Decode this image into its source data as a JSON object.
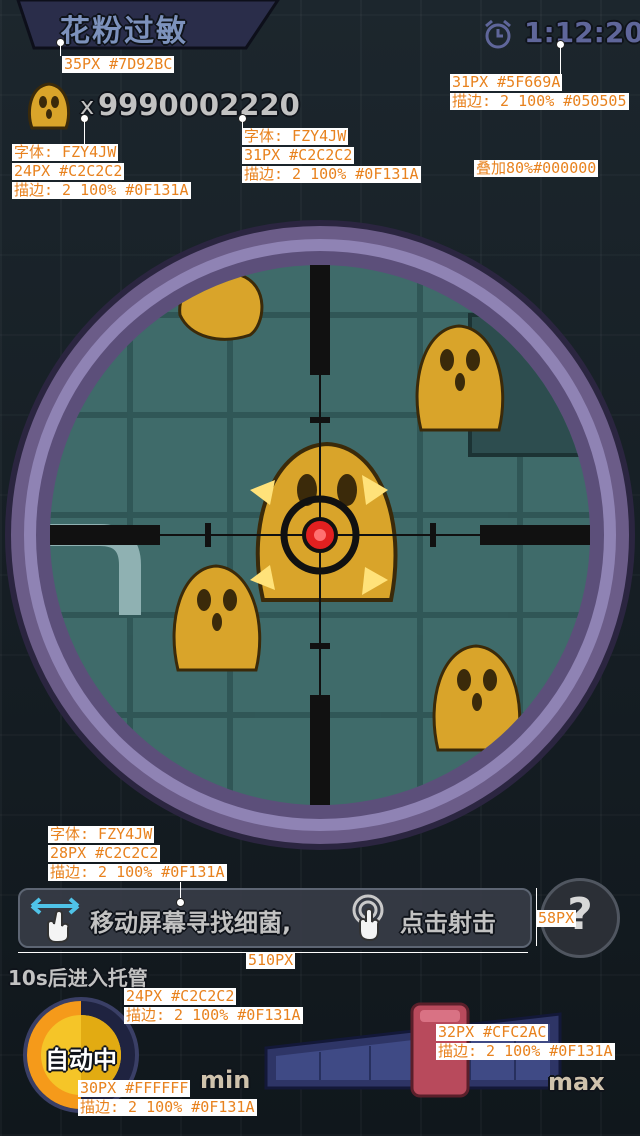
{
  "header": {
    "title": "花粉过敏",
    "timer": "1:12:20",
    "multiplier_prefix": "x",
    "count": "9990002220"
  },
  "scope": {
    "ring_color": "#7a6c9a",
    "lens_color": "#3f6b6a"
  },
  "hint": {
    "move_text": "移动屏幕寻找细菌,",
    "tap_text": "点击射击",
    "help_symbol": "?"
  },
  "auto": {
    "countdown_text": "10s后进入托管",
    "button_label": "自动中"
  },
  "power": {
    "min_label": "min",
    "max_label": "max"
  },
  "annotations": {
    "a1": "35PX #7D92BC",
    "a2": "31PX #5F669A",
    "a3": "描边: 2 100% #050505",
    "a4": "字体: FZY4JW",
    "a5": "24PX #C2C2C2",
    "a6": "描边: 2 100% #0F131A",
    "a7": "字体: FZY4JW",
    "a8": "31PX #C2C2C2",
    "a9": "描边: 2 100% #0F131A",
    "a10": "叠加80%#000000",
    "a11": "字体: FZY4JW",
    "a12": "28PX #C2C2C2",
    "a13": "描边: 2 100% #0F131A",
    "a14": "58PX",
    "a15": "510PX",
    "a16": "24PX #C2C2C2",
    "a17": "描边: 2 100% #0F131A",
    "a18": "32PX #CFC2AC",
    "a19": "描边: 2 100% #0F131A",
    "a20": "30PX #FFFFFF",
    "a21": "描边: 2 100% #0F131A"
  }
}
